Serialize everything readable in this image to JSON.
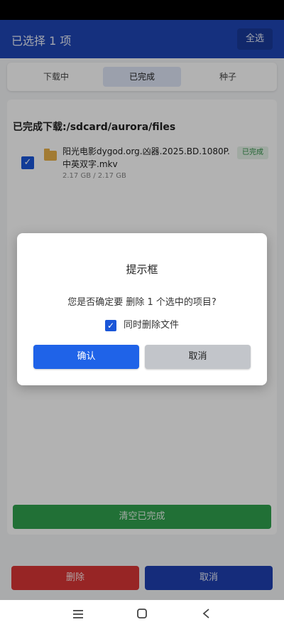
{
  "app_bar": {
    "title": "已选择 1 项",
    "select_all_label": "全选"
  },
  "tabs": [
    {
      "label": "下载中"
    },
    {
      "label": "已完成"
    },
    {
      "label": "种子"
    }
  ],
  "list": {
    "heading": "已完成下载:/sdcard/aurora/files",
    "items": [
      {
        "name": "阳光电影dygod.org.凶器.2025.BD.1080P.中英双字.mkv",
        "size": "2.17 GB / 2.17 GB",
        "status": "已完成",
        "checked": true
      }
    ]
  },
  "clear_button": "清空已完成",
  "bottom_bar": {
    "delete_label": "删除",
    "cancel_label": "取消"
  },
  "dialog": {
    "title": "提示框",
    "message": "您是否确定要 删除 1 个选中的项目?",
    "option_label": "同时删除文件",
    "option_checked": true,
    "confirm_label": "确认",
    "cancel_label": "取消"
  },
  "icons": {
    "checkbox": "check-icon",
    "folder": "folder-icon",
    "nav": [
      "menu-icon",
      "home-icon",
      "back-icon"
    ]
  },
  "colors": {
    "app_bar": "#1f45b5",
    "confirm": "#1f63e8",
    "clear": "#30a14e",
    "delete": "#d83535",
    "completed_badge": "#2e8f45"
  }
}
